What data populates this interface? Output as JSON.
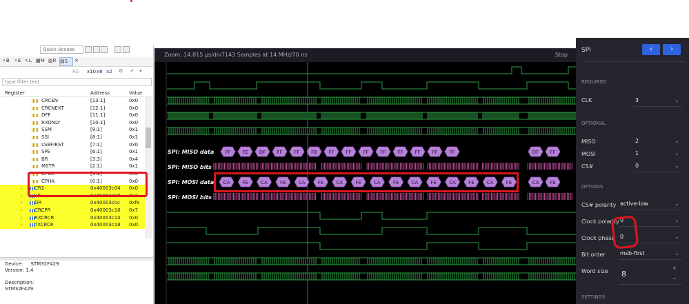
{
  "toolbar": {
    "quick_access": "Quick Access"
  },
  "left_tabs": [
    {
      "label": "B"
    },
    {
      "label": "E"
    },
    {
      "label": "L"
    },
    {
      "label": "M"
    },
    {
      "label": "R"
    },
    {
      "label": "S"
    }
  ],
  "left_toolbar": {
    "rd": "RD",
    "x10": "x10",
    "x8": "x8",
    "x2": "x2"
  },
  "register_view": {
    "filter_placeholder": "type filter text",
    "columns": {
      "register": "Register",
      "address": "Address",
      "value": "Value"
    },
    "rows": [
      {
        "name": "CRCEN",
        "address": "[13:1]",
        "value": "0x0",
        "hl": false
      },
      {
        "name": "CRCNEXT",
        "address": "[12:1]",
        "value": "0x0",
        "hl": false
      },
      {
        "name": "DFF",
        "address": "[11:1]",
        "value": "0x0",
        "hl": false
      },
      {
        "name": "RXONLY",
        "address": "[10:1]",
        "value": "0x0",
        "hl": false
      },
      {
        "name": "SSM",
        "address": "[9:1]",
        "value": "0x1",
        "hl": false
      },
      {
        "name": "SSI",
        "address": "[8:1]",
        "value": "0x1",
        "hl": false
      },
      {
        "name": "LSBFIRST",
        "address": "[7:1]",
        "value": "0x0",
        "hl": false
      },
      {
        "name": "SPE",
        "address": "[6:1]",
        "value": "0x1",
        "hl": false
      },
      {
        "name": "BR",
        "address": "[3:3]",
        "value": "0x4",
        "hl": false
      },
      {
        "name": "MSTR",
        "address": "[2:1]",
        "value": "0x1",
        "hl": false
      },
      {
        "name": "CPOL",
        "address": "[1:1]",
        "value": "0x0",
        "hl": false
      },
      {
        "name": "CPHA",
        "address": "[0:1]",
        "value": "0x0",
        "hl": false
      },
      {
        "name": "CR2",
        "address": "0x40003c04",
        "value": "0x0",
        "hl": true
      },
      {
        "name": "SR",
        "address": "0x40003c08",
        "value": "0x3",
        "hl": true
      },
      {
        "name": "DR",
        "address": "0x40003c0c",
        "value": "0xfe",
        "hl": true
      },
      {
        "name": "CRCPR",
        "address": "0x40003c10",
        "value": "0x7",
        "hl": true
      },
      {
        "name": "RXCRCR",
        "address": "0x40003c14",
        "value": "0x0",
        "hl": true
      },
      {
        "name": "TXCRCR",
        "address": "0x40003c18",
        "value": "0x0",
        "hl": true
      }
    ],
    "device_label": "Device:",
    "device": "STM32F429",
    "version": "Version: 1.4",
    "description_label": "Description:",
    "description": "STM32F429"
  },
  "logic_analyzer": {
    "header": "Zoom: 14.815 µs/div7143 Samples at 14 MHz/70 ns",
    "stop": "Stop",
    "miso_data_label": "SPI: MISO data",
    "miso_bits_label": "SPI: MISO bits",
    "mosi_data_label": "SPI: MOSI data",
    "mosi_bits_label": "SPI: MOSI bits",
    "miso_bytes": [
      "FF",
      "FE",
      "DF",
      "FF",
      "FF",
      "FB",
      "FF",
      "FF",
      "FF",
      "FF",
      "FF",
      "FF",
      "FF",
      "FF"
    ],
    "miso_bytes_right": [
      "DF",
      "FF"
    ],
    "mosi_bytes": [
      "CA",
      "FE",
      "CA",
      "FE",
      "CA",
      "FE",
      "CA",
      "FE",
      "CA",
      "FE",
      "CA",
      "FE",
      "CA",
      "FE",
      "CA",
      "FE"
    ],
    "mosi_bytes_right": [
      "CA",
      "FE"
    ]
  },
  "settings": {
    "title": "SPI",
    "required": "REQUIRED",
    "clk_label": "CLK",
    "clk_value": "3",
    "optional": "OPTIONAL",
    "miso_label": "MISO",
    "miso_value": "2",
    "mosi_label": "MOSI",
    "mosi_value": "1",
    "cs_label": "CS#",
    "cs_value": "0",
    "options": "OPTIONS",
    "cs_polarity_label": "CS# polarity",
    "cs_polarity_value": "active-low",
    "clock_polarity_label": "Clock polarity",
    "clock_polarity_value": "0",
    "clock_phase_label": "Clock phase",
    "clock_phase_value": "0",
    "bit_order_label": "Bit order",
    "bit_order_value": "msb-first",
    "word_size_label": "Word size",
    "word_size_value": "8",
    "settings_section": "SETTINGS",
    "prev": "‹",
    "next": "›",
    "plus": "+",
    "minus": "−"
  }
}
